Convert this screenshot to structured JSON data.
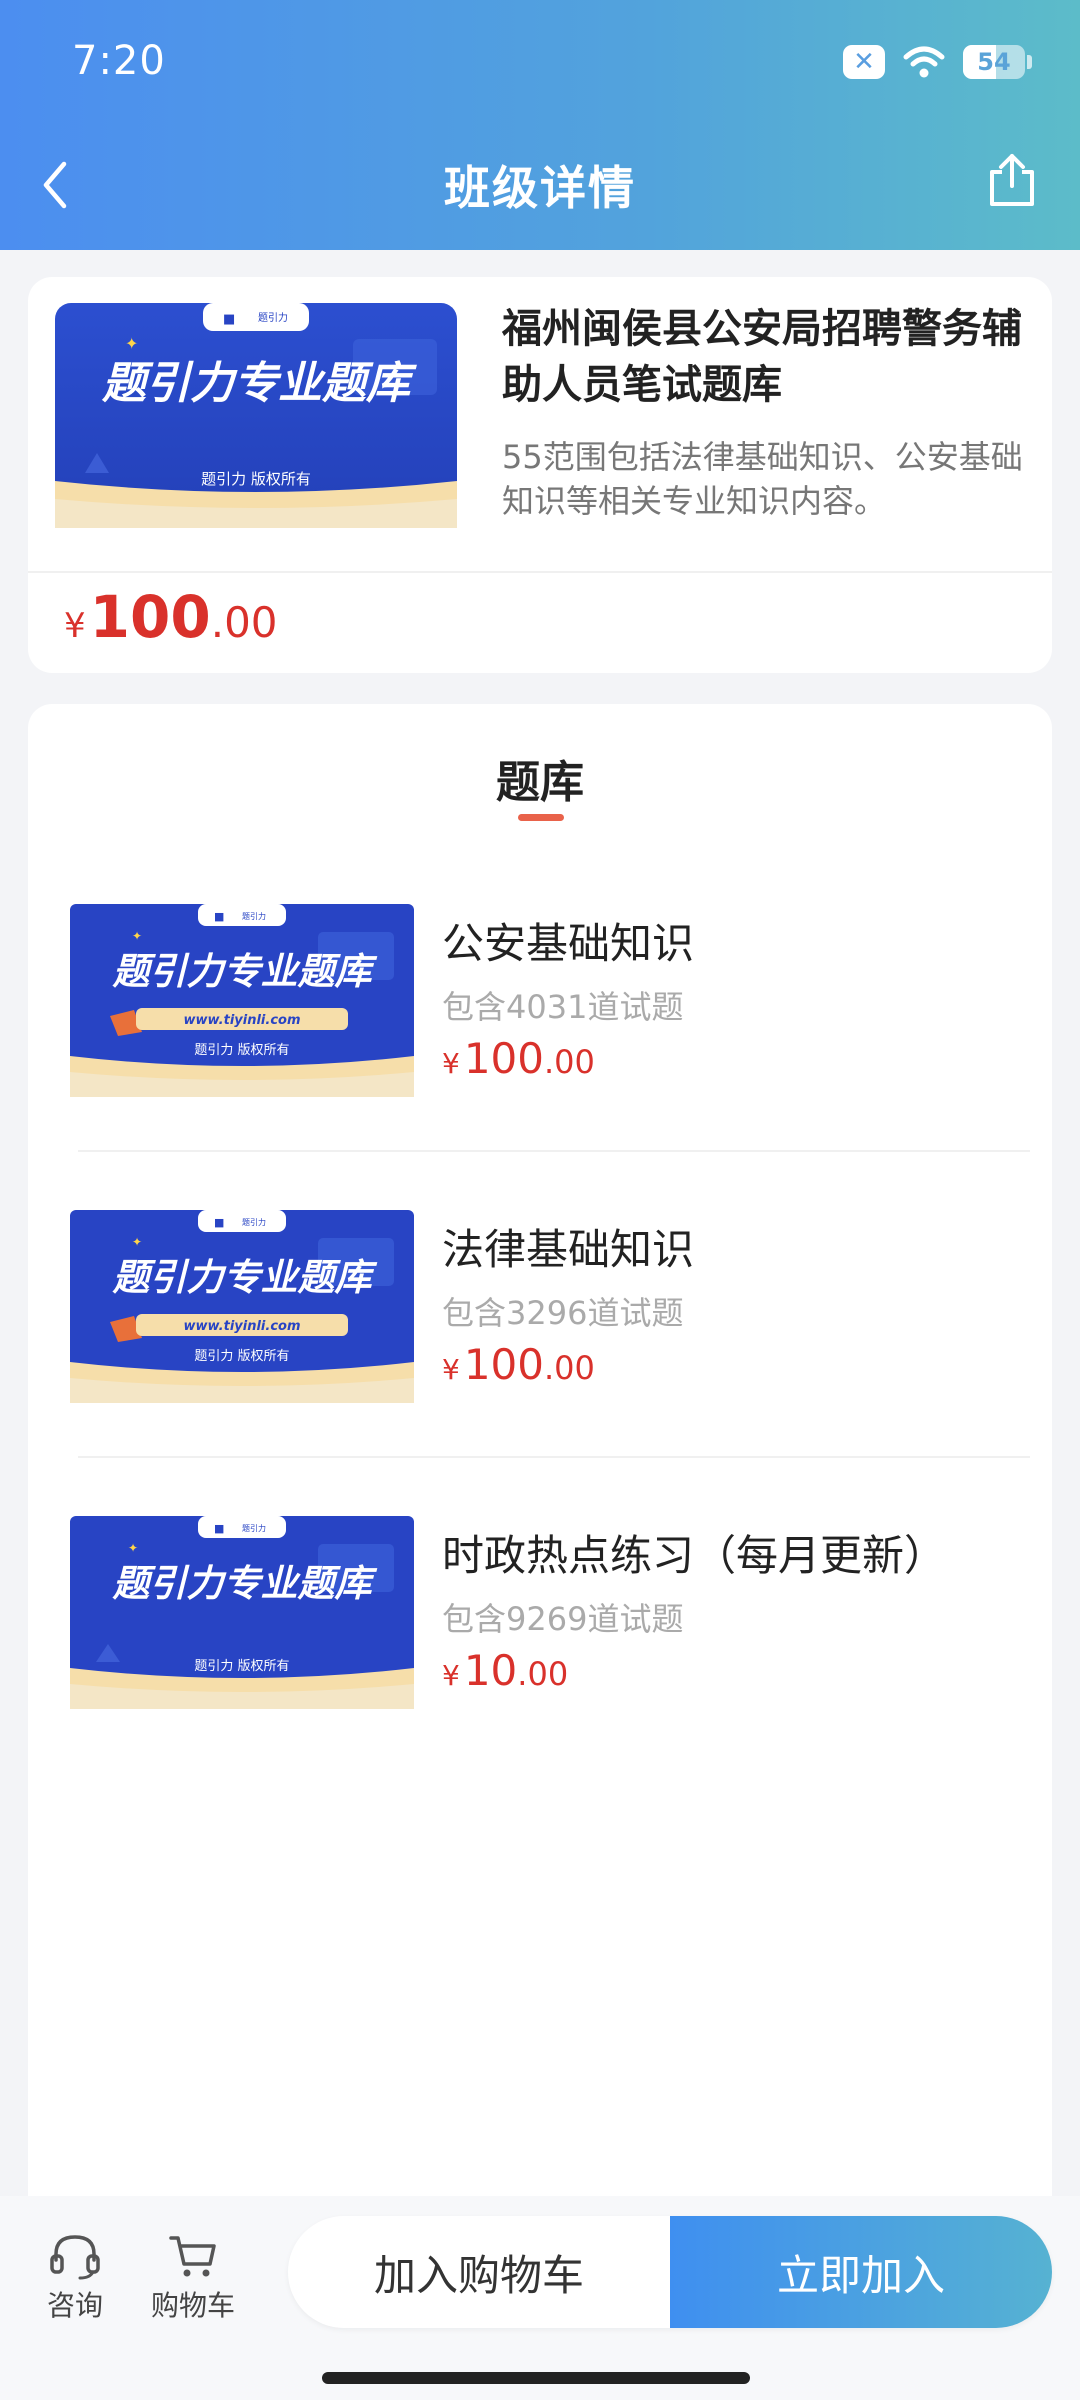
{
  "status_bar": {
    "time": "7:20",
    "battery": "54",
    "battery_level": 0.54
  },
  "nav": {
    "title": "班级详情"
  },
  "colors": {
    "accent": "#4c8ef0",
    "price": "#d9312b",
    "tab_underline": "#e9624a",
    "banner_blue": "#2844c4"
  },
  "course": {
    "title": "福州闽侯县公安局招聘警务辅助人员笔试题库",
    "description": "55范围包括法律基础知识、公安基础知识等相关专业知识内容。",
    "price_symbol": "¥",
    "price_int": "100",
    "price_dec": ".00",
    "banner": {
      "logo_text": "题引力",
      "headline": "题引力专业题库",
      "footer": "题引力 版权所有"
    }
  },
  "bank": {
    "tab_label": "题库",
    "items": [
      {
        "title": "公安基础知识",
        "count": "包含4031道试题",
        "price_symbol": "¥",
        "price_int": "100",
        "price_dec": ".00",
        "banner": {
          "logo_text": "题引力",
          "headline": "题引力专业题库",
          "url": "www.tiyinli.com",
          "footer": "题引力 版权所有"
        }
      },
      {
        "title": "法律基础知识",
        "count": "包含3296道试题",
        "price_symbol": "¥",
        "price_int": "100",
        "price_dec": ".00",
        "banner": {
          "logo_text": "题引力",
          "headline": "题引力专业题库",
          "url": "www.tiyinli.com",
          "footer": "题引力 版权所有"
        }
      },
      {
        "title": "时政热点练习（每月更新）",
        "count": "包含9269道试题",
        "price_symbol": "¥",
        "price_int": "10",
        "price_dec": ".00",
        "banner": {
          "logo_text": "题引力",
          "headline": "题引力专业题库",
          "footer": "题引力 版权所有"
        }
      }
    ]
  },
  "bottom_bar": {
    "consult_label": "咨询",
    "cart_label": "购物车",
    "add_cart_label": "加入购物车",
    "join_now_label": "立即加入"
  }
}
